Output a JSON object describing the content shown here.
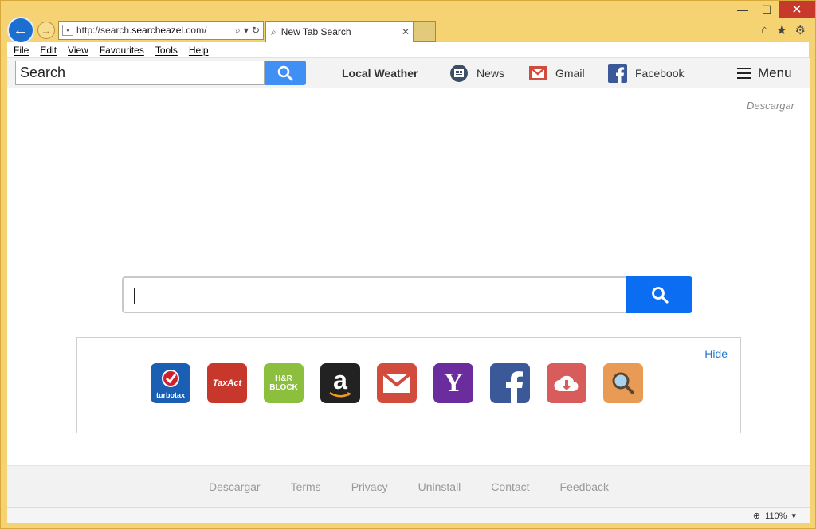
{
  "window": {
    "minimize": "—",
    "maximize": "☐",
    "close": "✕"
  },
  "nav": {
    "back_icon": "←",
    "forward_icon": "→",
    "url_prefix": "http://search.",
    "url_domain": "searcheazel",
    "url_suffix": ".com/",
    "search_glyph": "⌕",
    "dropdown_glyph": "▾",
    "refresh_glyph": "↻",
    "tab_title": "New Tab Search",
    "tab_close": "✕",
    "home_icon": "⌂",
    "star_icon": "★",
    "gear_icon": "⚙"
  },
  "menubar": {
    "items": [
      "File",
      "Edit",
      "View",
      "Favourites",
      "Tools",
      "Help"
    ]
  },
  "toolbar": {
    "search_value": "Search",
    "local_weather": "Local Weather",
    "news": "News",
    "gmail": "Gmail",
    "facebook": "Facebook",
    "menu": "Menu"
  },
  "page": {
    "descargar_top": "Descargar",
    "hide": "Hide",
    "shortcuts": [
      {
        "icon": "turbotax-icon",
        "label": "turbotax",
        "color": "#1a5fb4"
      },
      {
        "icon": "taxact-icon",
        "label": "TaxAct",
        "color": "#c8372b"
      },
      {
        "icon": "hr-block-icon",
        "label": "H&R BLOCK",
        "color": "#8dbf3f"
      },
      {
        "icon": "amazon-icon",
        "label": "a",
        "color": "#222222"
      },
      {
        "icon": "gmail-icon",
        "label": "✉",
        "color": "#d24c3e"
      },
      {
        "icon": "yahoo-icon",
        "label": "Y",
        "color": "#6b2c9e"
      },
      {
        "icon": "facebook-icon",
        "label": "f",
        "color": "#3b5998"
      },
      {
        "icon": "download-icon",
        "label": "⬇",
        "color": "#d95c5c"
      },
      {
        "icon": "search-icon",
        "label": "⌕",
        "color": "#e99a55"
      }
    ]
  },
  "footer": {
    "links": [
      "Descargar",
      "Terms",
      "Privacy",
      "Uninstall",
      "Contact",
      "Feedback"
    ]
  },
  "status": {
    "zoom": "110%",
    "zoom_icon": "🔍",
    "zoom_dropdown": "▾"
  }
}
